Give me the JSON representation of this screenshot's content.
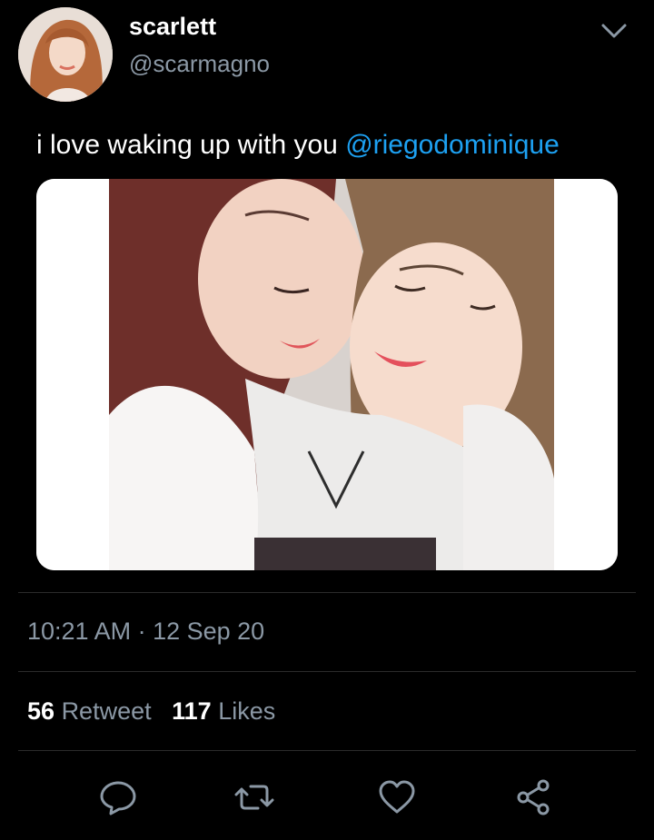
{
  "user": {
    "display_name": "scarlett",
    "handle": "@scarmagno"
  },
  "tweet": {
    "text": "i love waking up with you ",
    "mention": "@riegodominique",
    "timestamp": "10:21 AM · 12 Sep 20"
  },
  "stats": {
    "retweet_count": "56",
    "retweet_label": "Retweet",
    "likes_count": "117",
    "likes_label": "Likes"
  },
  "icons": {
    "menu": "chevron-down-icon",
    "reply": "reply-icon",
    "retweet": "retweet-icon",
    "like": "heart-icon",
    "share": "share-icon"
  },
  "colors": {
    "background": "#000000",
    "primary_text": "#ffffff",
    "secondary_text": "#8b98a5",
    "mention": "#1da1f2",
    "divider": "#2b2b2b"
  }
}
